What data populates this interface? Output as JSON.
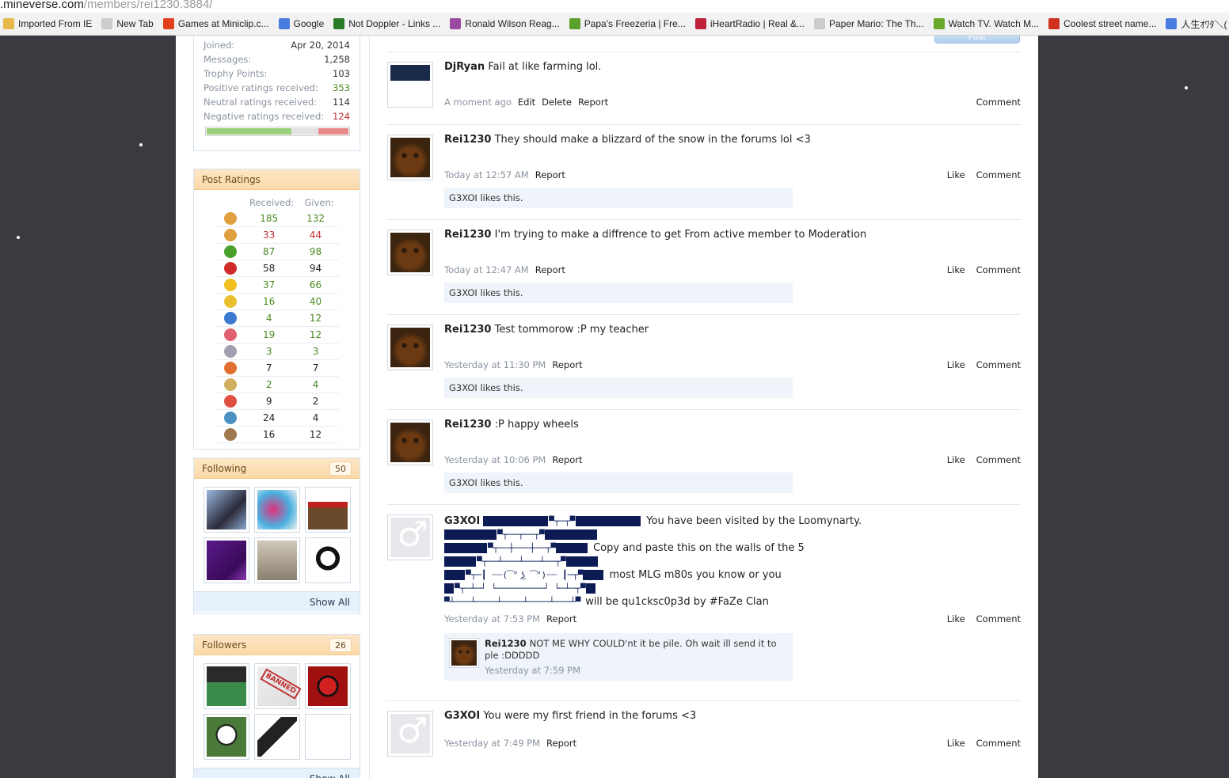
{
  "browser": {
    "url_domain": ".mineverse.com",
    "url_path": "/members/rei1230.3884/",
    "bookmarks": [
      {
        "label": "Imported From IE",
        "icon": "folder-icon",
        "color": "#e8b84a"
      },
      {
        "label": "New Tab",
        "icon": "page-icon",
        "color": "#cccccc"
      },
      {
        "label": "Games at Miniclip.c...",
        "icon": "miniclip-icon",
        "color": "#e0401a"
      },
      {
        "label": "Google",
        "icon": "google-icon",
        "color": "#4a7be0"
      },
      {
        "label": "Not Doppler - Links ...",
        "icon": "notdoppler-icon",
        "color": "#2a7a2a"
      },
      {
        "label": "Ronald Wilson Reag...",
        "icon": "wikipedia-icon",
        "color": "#9a4aa0"
      },
      {
        "label": "Papa's Freezeria | Fre...",
        "icon": "papas-icon",
        "color": "#5aa02a"
      },
      {
        "label": "iHeartRadio | Real &...",
        "icon": "iheart-icon",
        "color": "#c0203a"
      },
      {
        "label": "Paper Mario: The Th...",
        "icon": "page-icon",
        "color": "#cccccc"
      },
      {
        "label": "Watch TV. Watch M...",
        "icon": "hulu-icon",
        "color": "#6aa82a"
      },
      {
        "label": "Coolest street name...",
        "icon": "reddit-icon",
        "color": "#d03020"
      },
      {
        "label": "人生ｵﾜﾀ＼(",
        "icon": "google-icon",
        "color": "#4a7be0"
      }
    ]
  },
  "stats": {
    "joined_label": "Joined:",
    "joined_value": "Apr 20, 2014",
    "messages_label": "Messages:",
    "messages_value": "1,258",
    "trophy_label": "Trophy Points:",
    "trophy_value": "103",
    "positive_label": "Positive ratings received:",
    "positive_value": "353",
    "neutral_label": "Neutral ratings received:",
    "neutral_value": "114",
    "negative_label": "Negative ratings received:",
    "negative_value": "124",
    "ratio": {
      "positive": 0.6,
      "neutral": 0.19,
      "negative": 0.21
    }
  },
  "post_ratings": {
    "title": "Post Ratings",
    "received_label": "Received:",
    "given_label": "Given:",
    "rows": [
      {
        "icon": "like-icon",
        "color": "#e0a040",
        "received": "185",
        "given": "132",
        "rc": "g",
        "gc": "g"
      },
      {
        "icon": "dislike-icon",
        "color": "#e0a040",
        "received": "33",
        "given": "44",
        "rc": "r",
        "gc": "r"
      },
      {
        "icon": "agree-icon",
        "color": "#4aa02a",
        "received": "87",
        "given": "98",
        "rc": "g",
        "gc": "g"
      },
      {
        "icon": "disagree-icon",
        "color": "#d02a2a",
        "received": "58",
        "given": "94",
        "rc": "",
        "gc": ""
      },
      {
        "icon": "funny-icon",
        "color": "#f0c020",
        "received": "37",
        "given": "66",
        "rc": "g",
        "gc": "g"
      },
      {
        "icon": "winner-icon",
        "color": "#e8c030",
        "received": "16",
        "given": "40",
        "rc": "g",
        "gc": "g"
      },
      {
        "icon": "informative-icon",
        "color": "#3a7ad0",
        "received": "4",
        "given": "12",
        "rc": "g",
        "gc": "g"
      },
      {
        "icon": "friendly-icon",
        "color": "#e06070",
        "received": "19",
        "given": "12",
        "rc": "g",
        "gc": "g"
      },
      {
        "icon": "useful-icon",
        "color": "#a0a0b0",
        "received": "3",
        "given": "3",
        "rc": "g",
        "gc": "g"
      },
      {
        "icon": "creative-icon",
        "color": "#e07030",
        "received": "7",
        "given": "7",
        "rc": "",
        "gc": ""
      },
      {
        "icon": "optimistic-icon",
        "color": "#d0b060",
        "received": "2",
        "given": "4",
        "rc": "g",
        "gc": "g"
      },
      {
        "icon": "late-icon",
        "color": "#e05040",
        "received": "9",
        "given": "2",
        "rc": "",
        "gc": ""
      },
      {
        "icon": "spelling-icon",
        "color": "#4a90c0",
        "received": "24",
        "given": "4",
        "rc": "",
        "gc": ""
      },
      {
        "icon": "cookie-icon",
        "color": "#a07850",
        "received": "16",
        "given": "12",
        "rc": "",
        "gc": ""
      }
    ]
  },
  "following": {
    "title": "Following",
    "count": "50",
    "show_all": "Show All",
    "avatars": [
      {
        "name": "following-avatar-1",
        "bg": "linear-gradient(135deg,#9ab8e0,#2a2a3a 60%,#8aa8d0)"
      },
      {
        "name": "following-avatar-2",
        "bg": "radial-gradient(circle at 40% 50%,#e0307a,#4ab0e0 55%,#f0f0f0)"
      },
      {
        "name": "following-avatar-3",
        "bg": "linear-gradient(#fff 0 30%,#c02020 30% 45%,#6a4a2a 45%)"
      },
      {
        "name": "following-avatar-4",
        "bg": "linear-gradient(135deg,#5a1a8a,#3a0a5a 70%,#8a3ab0)"
      },
      {
        "name": "following-avatar-5",
        "bg": "linear-gradient(#d0c8b8,#8a8070)"
      },
      {
        "name": "following-avatar-6",
        "bg": "radial-gradient(circle at 50% 45%,#fff 0 25%,#111 26% 40%,#fff 41%)"
      }
    ]
  },
  "followers": {
    "title": "Followers",
    "count": "26",
    "avatars": [
      {
        "name": "follower-avatar-1",
        "bg": "linear-gradient(#2a2a2a 0 40%,#3a8a4a 40%)"
      },
      {
        "name": "follower-avatar-2",
        "bg": "linear-gradient(135deg,#eee,#ddd)",
        "banned": "BANNED"
      },
      {
        "name": "follower-avatar-3",
        "bg": "radial-gradient(circle,#d02020 0 30%,#111 31% 38%,#a01010 39%)"
      },
      {
        "name": "follower-avatar-4",
        "bg": "radial-gradient(circle at 50% 45%,#fff 0 30%,#222 31% 36%,#4a7a3a 37%)"
      },
      {
        "name": "follower-avatar-5",
        "bg": "linear-gradient(135deg,#fff 0 30%,#222 30% 55%,#fff 55%)"
      },
      {
        "name": "follower-avatar-6",
        "bg": "#ffffff"
      }
    ],
    "show_all": "Show All"
  },
  "feed": {
    "post_button": "Post",
    "actions": {
      "like": "Like",
      "comment": "Comment",
      "report": "Report",
      "edit": "Edit",
      "delete": "Delete"
    },
    "posts": [
      {
        "user": "DjRyan",
        "text": "Fail at like farming lol.",
        "time": "A moment ago",
        "avatar": "djryan",
        "likes": ""
      },
      {
        "user": "Rei1230",
        "text": "They should make a blizzard of the snow in the forums lol <3",
        "time": "Today at 12:57 AM",
        "avatar": "fred",
        "likes": "G3XOI likes this."
      },
      {
        "user": "Rei1230",
        "text": "I'm trying to make a diffrence to get From active member to Moderation",
        "time": "Today at 12:47 AM",
        "avatar": "fred",
        "likes": "G3XOI likes this."
      },
      {
        "user": "Rei1230",
        "text": "Test tommorow :P my teacher",
        "time": "Yesterday at 11:30 PM",
        "avatar": "fred",
        "likes": "G3XOI likes this."
      },
      {
        "user": "Rei1230",
        "text": ":P happy wheels",
        "time": "Yesterday at 10:06 PM",
        "avatar": "fred",
        "likes": "G3XOI likes this."
      }
    ],
    "ascii_post": {
      "user": "G3XOI",
      "line1": "You have been visited by the Loomynarty.",
      "line3": "Copy and paste this on the walls of the 5",
      "line5": "most MLG m80s you know or you",
      "line7": "will be qu1cksc0p3d by #FaZe Clan",
      "face": "┃ ┈┈(͡° ͜ʖ ͡°)┈┈ ┃",
      "time": "Yesterday at 7:53 PM",
      "reply": {
        "user": "Rei1230",
        "text": "NOT ME WHY COULD'nt it be pile. Oh wait ill send it to ple :DDDDD",
        "time": "Yesterday at 7:59 PM"
      }
    },
    "last_post": {
      "user": "G3XOI",
      "text": "You were my first friend in the forums <3",
      "time": "Yesterday at 7:49 PM"
    }
  }
}
